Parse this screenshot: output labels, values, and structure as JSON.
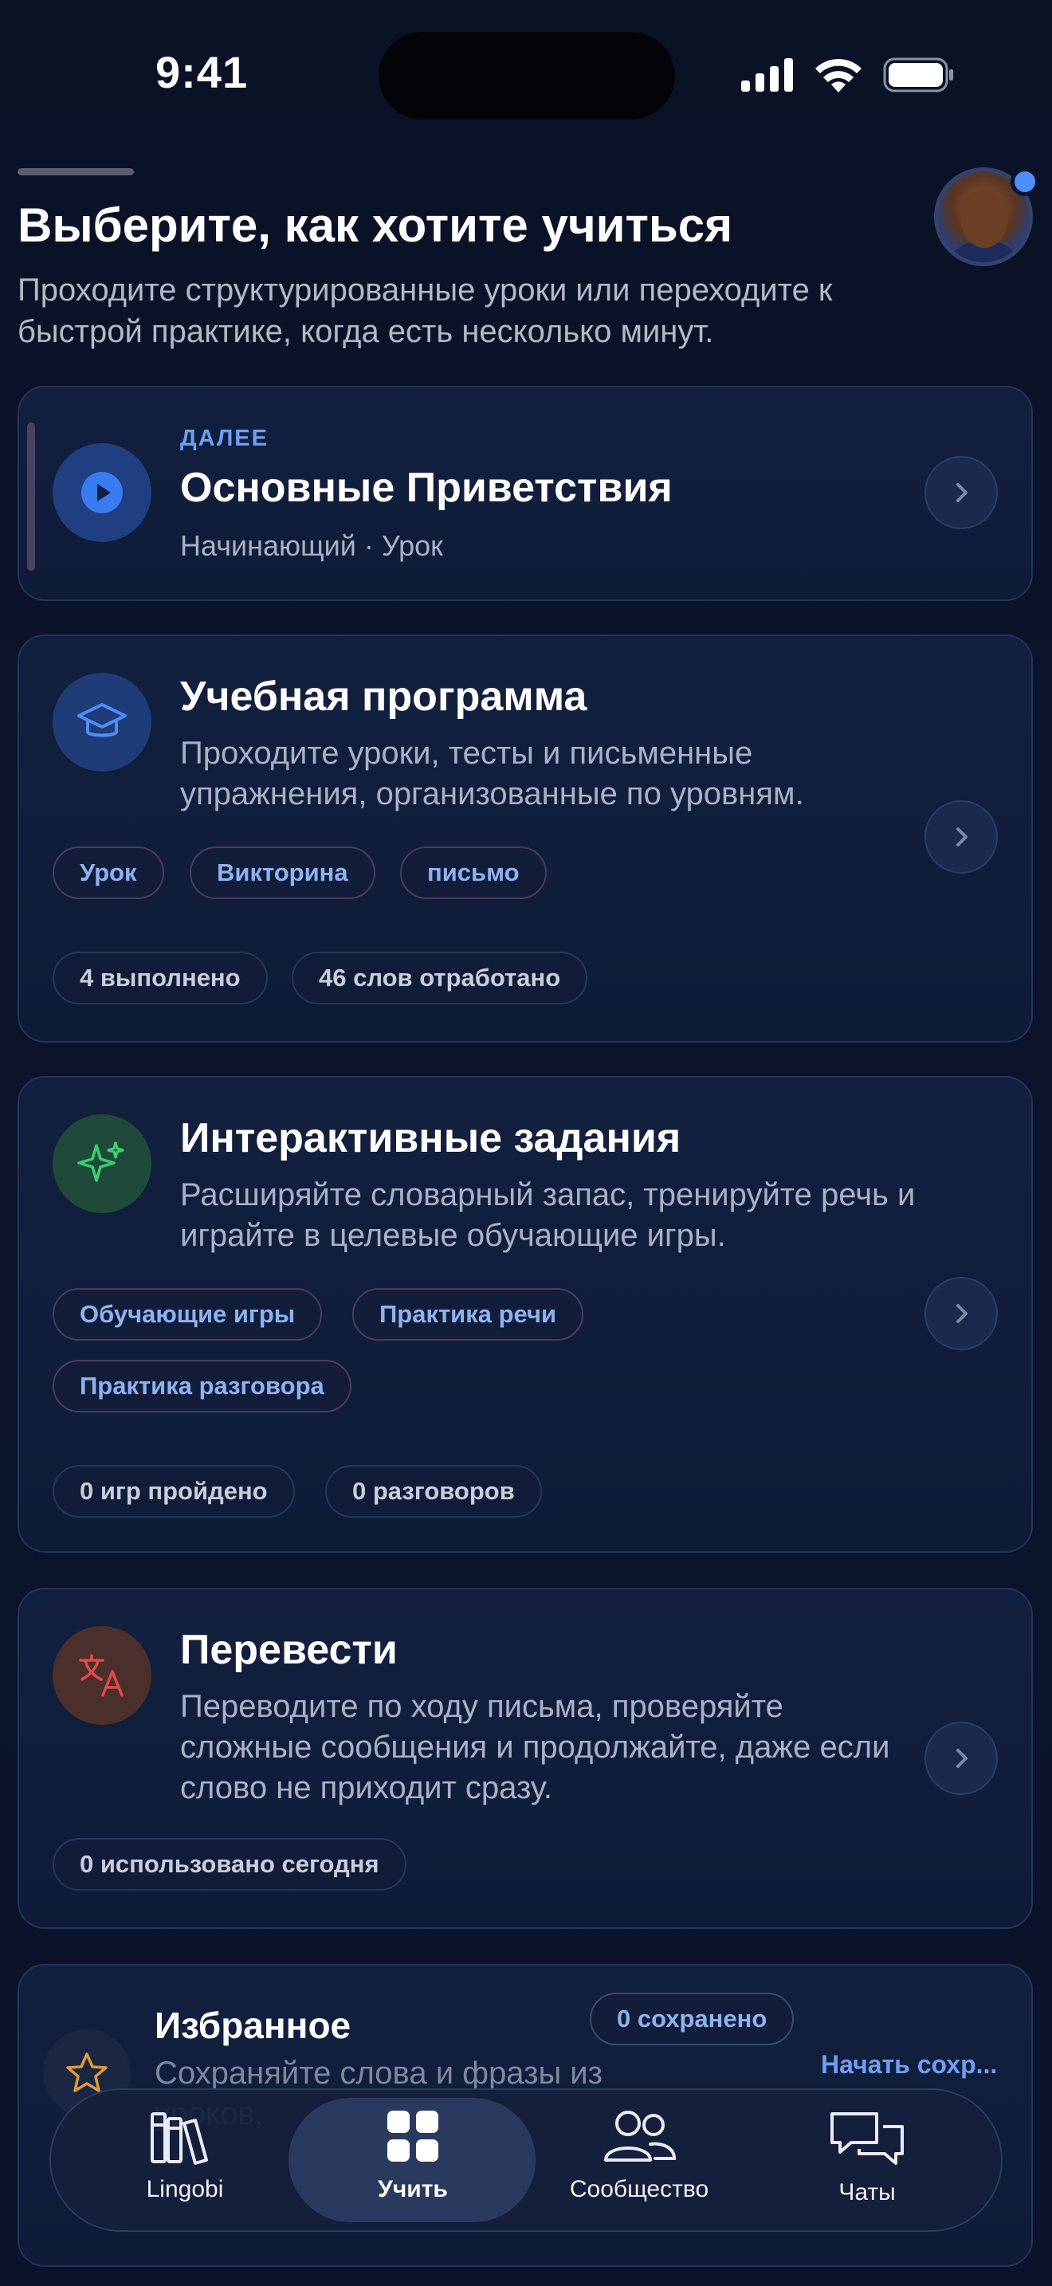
{
  "status_bar": {
    "time": "9:41"
  },
  "header": {
    "title": "Выберите, как хотите учиться",
    "subtitle": "Проходите структурированные уроки или переходите к быстрой практике, когда есть несколько минут."
  },
  "next_lesson": {
    "eyebrow": "ДАЛЕЕ",
    "title": "Основные Приветствия",
    "meta": "Начинающий · Урок"
  },
  "curriculum": {
    "title": "Учебная программа",
    "description": "Проходите уроки, тесты и письменные упражнения, организованные по уровням.",
    "tags": [
      "Урок",
      "Викторина",
      "письмо"
    ],
    "stats": [
      "4 выполнено",
      "46 слов отработано"
    ]
  },
  "interactive": {
    "title": "Интерактивные задания",
    "description": "Расширяйте словарный запас, тренируйте речь и играйте в целевые обучающие игры.",
    "tags": [
      "Обучающие игры",
      "Практика речи",
      "Практика разговора"
    ],
    "stats": [
      "0 игр пройдено",
      "0 разговоров"
    ]
  },
  "translate": {
    "title": "Перевести",
    "description": "Переводите по ходу письма, проверяйте сложные сообщения и продолжайте, даже если слово не приходит сразу.",
    "stats": [
      "0 использовано сегодня"
    ]
  },
  "favorites": {
    "title": "Избранное",
    "badge": "0 сохранено",
    "description": "Сохраняйте слова и фразы из уроков,",
    "action": "Начать сохр..."
  },
  "nav": {
    "items": [
      {
        "label": "Lingobi",
        "icon": "library-icon"
      },
      {
        "label": "Учить",
        "icon": "grid-icon",
        "active": true
      },
      {
        "label": "Сообщество",
        "icon": "community-icon"
      },
      {
        "label": "Чаты",
        "icon": "chat-icon"
      }
    ]
  },
  "colors": {
    "background": "#0b142b",
    "accent": "#4f8df7",
    "green": "#3bd170",
    "red": "#e5484d",
    "orange": "#e09a3a"
  }
}
